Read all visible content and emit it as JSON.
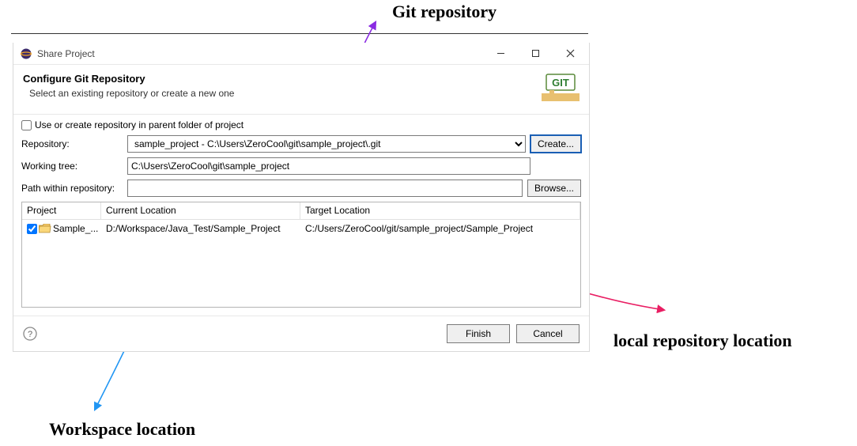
{
  "annotations": {
    "git_repo": "Git repository",
    "workspace_loc": "Workspace location",
    "local_repo_loc": "local repository location"
  },
  "titlebar": {
    "title": "Share Project"
  },
  "header": {
    "title": "Configure Git Repository",
    "subtitle": "Select an existing repository or create a new one"
  },
  "git_badge": "GIT",
  "body": {
    "parent_folder_checkbox_label": "Use or create repository in parent folder of project",
    "parent_folder_checked": false,
    "repo_label": "Repository:",
    "repo_value": "sample_project - C:\\Users\\ZeroCool\\git\\sample_project\\.git",
    "create_button": "Create...",
    "working_tree_label": "Working tree:",
    "working_tree_value": "C:\\Users\\ZeroCool\\git\\sample_project",
    "path_label": "Path within repository:",
    "path_value": "",
    "browse_button": "Browse..."
  },
  "table": {
    "headers": {
      "project": "Project",
      "current": "Current Location",
      "target": "Target Location"
    },
    "rows": [
      {
        "checked": true,
        "project": "Sample_...",
        "current": "D:/Workspace/Java_Test/Sample_Project",
        "target": "C:/Users/ZeroCool/git/sample_project/Sample_Project"
      }
    ]
  },
  "buttons": {
    "finish": "Finish",
    "cancel": "Cancel"
  }
}
